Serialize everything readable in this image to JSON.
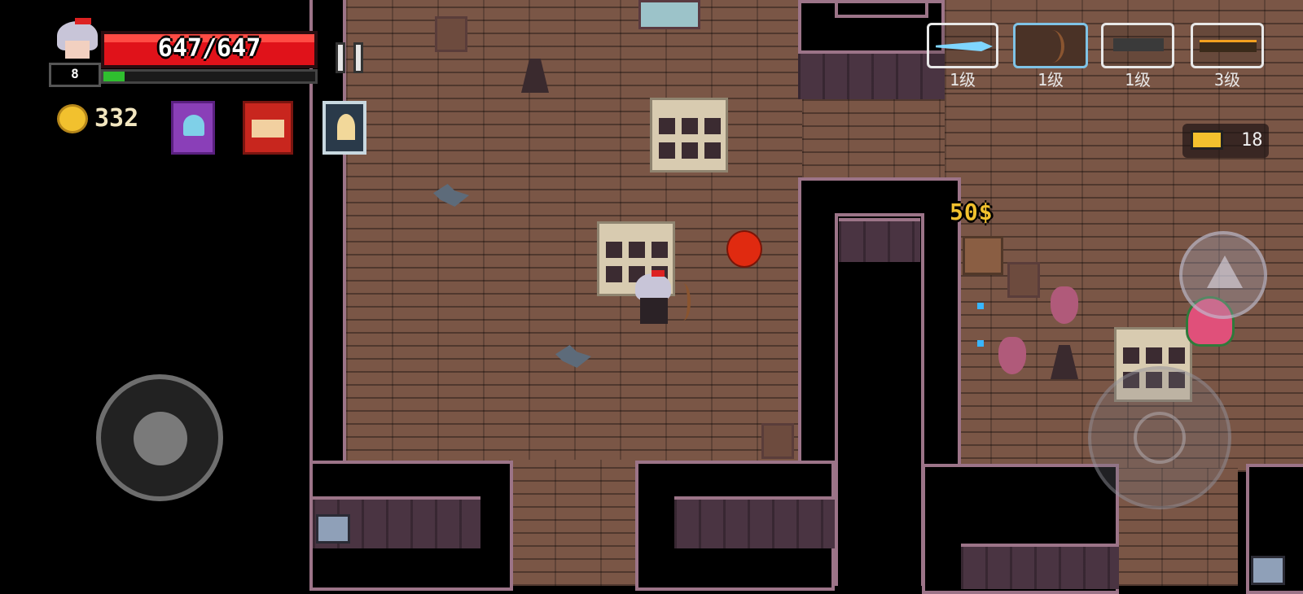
{
  "player": {
    "hp": "647/647",
    "level": "8",
    "xp_fraction": 0.1
  },
  "gold": {
    "amount": "332"
  },
  "weapons": [
    {
      "name": "frost-sword-icon",
      "level": "1级"
    },
    {
      "name": "bow-icon",
      "level": "1级"
    },
    {
      "name": "smg-icon",
      "level": "1级"
    },
    {
      "name": "rifle-icon",
      "level": "3级"
    }
  ],
  "ammo": {
    "count": "18"
  },
  "shop": {
    "price": "50$"
  },
  "colors": {
    "hp": "#e0121a",
    "xp": "#2fbf2f",
    "gold": "#f2c12e",
    "accent": "#9c7488"
  }
}
